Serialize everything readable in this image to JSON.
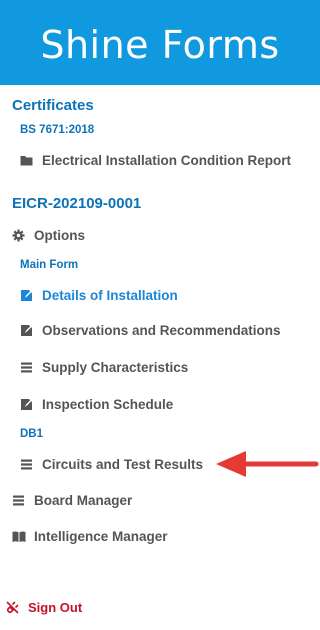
{
  "header": {
    "title": "Shine Forms"
  },
  "certificates": {
    "title": "Certificates",
    "standard": "BS 7671:2018",
    "report": {
      "label": "Electrical Installation Condition Report",
      "icon": "folder-icon"
    }
  },
  "document": {
    "id": "EICR-202109-0001",
    "options_label": "Options",
    "main_form_label": "Main Form",
    "main_items": [
      {
        "label": "Details of Installation",
        "icon": "edit-icon",
        "active": true
      },
      {
        "label": "Observations and Recommendations",
        "icon": "edit-icon",
        "active": false
      },
      {
        "label": "Supply Characteristics",
        "icon": "layers-icon",
        "active": false
      },
      {
        "label": "Inspection Schedule",
        "icon": "edit-icon",
        "active": false
      }
    ],
    "db_label": "DB1",
    "db_items": [
      {
        "label": "Circuits and Test Results",
        "icon": "layers-icon"
      }
    ]
  },
  "nav": {
    "board_manager": "Board Manager",
    "intelligence_manager": "Intelligence Manager"
  },
  "footer": {
    "sign_out": "Sign Out"
  },
  "colors": {
    "header_bg": "#1199e0",
    "accent": "#0d73b8",
    "active": "#1b86d6",
    "text": "#555555",
    "sign_out": "#c8102e",
    "annotation_arrow": "#e53935"
  }
}
